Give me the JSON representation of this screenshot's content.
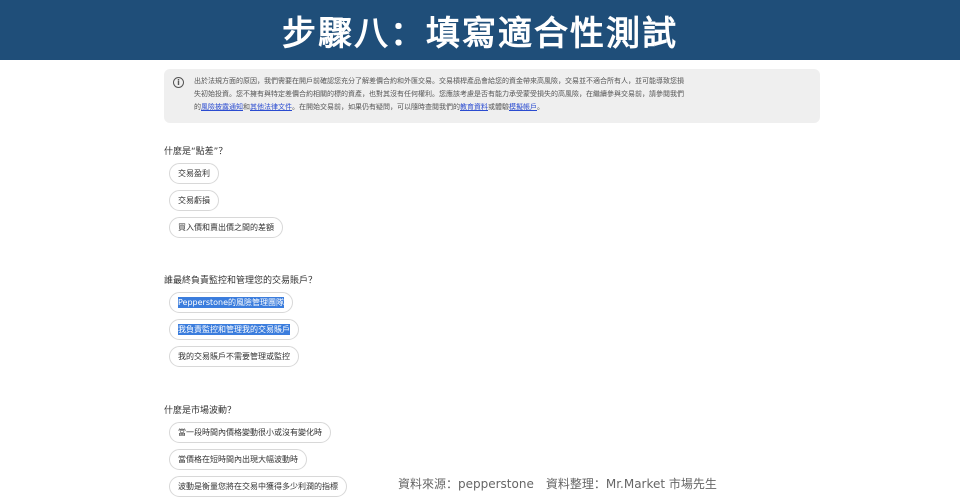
{
  "banner": {
    "title": "步驟八：填寫適合性測試"
  },
  "notice": {
    "icon": "info-icon",
    "text_1": "出於法規方面的原因，我們需要在開戶前確認您充分了解差價合約和外匯交易。交易槓桿產品會給您的資金帶來高風險，交易並不適合所有人，並可能導致您損",
    "text_2": "失初始投資。您不擁有與特定差價合約相關的標的資產，也對其沒有任何權利。您應該考慮是否有能力承受蒙受損失的高風險，在繼續參與交易前，請參閱我們",
    "text_3_a": "的",
    "link_risk": "風險披露通知",
    "text_3_b": "和",
    "link_legal": "其他法律文件",
    "text_3_c": "。在開始交易前，如果仍有疑問，可以隨時查閱我們的",
    "link_edu": "教育資料",
    "text_3_d": "或體驗",
    "link_demo": "模擬帳戶",
    "text_3_e": "。"
  },
  "questions": [
    {
      "label": "什麼是“點差”？",
      "options": [
        "交易盈利",
        "交易虧損",
        "買入價和賣出價之間的差額"
      ]
    },
    {
      "label": "誰最終負責監控和管理您的交易賬戶？",
      "options": [
        "Pepperstone的風險管理團隊",
        "我負責監控和管理我的交易賬戶",
        "我的交易賬戶不需要管理或監控"
      ]
    },
    {
      "label": "什麼是市場波動？",
      "options": [
        "當一段時間內價格變動很小或沒有變化時",
        "當價格在短時間內出現大幅波動時",
        "波動是衡量您將在交易中獲得多少利潤的指標"
      ]
    }
  ],
  "source": "資料來源：pepperstone　資料整理：Mr.Market  市場先生"
}
